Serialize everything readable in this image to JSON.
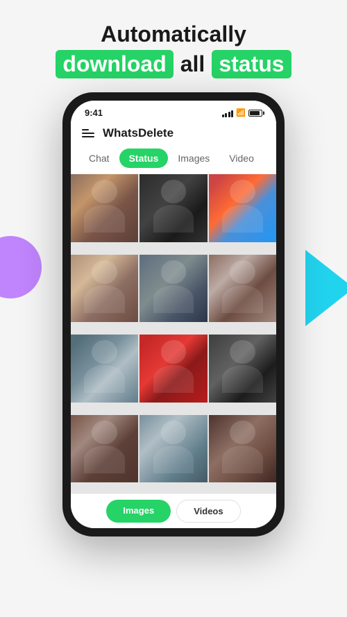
{
  "hero": {
    "line1": "Automatically",
    "highlight1": "download",
    "plain": "all",
    "highlight2": "status"
  },
  "phone": {
    "statusBar": {
      "time": "9:41"
    },
    "header": {
      "appName": "WhatsDelete"
    },
    "tabs": [
      {
        "label": "Chat",
        "active": false
      },
      {
        "label": "Status",
        "active": true
      },
      {
        "label": "Images",
        "active": false
      },
      {
        "label": "Video",
        "active": false
      }
    ],
    "bottomNav": {
      "btn1": "Images",
      "btn2": "Videos"
    }
  },
  "photos": [
    {
      "id": 1,
      "class": "person-1"
    },
    {
      "id": 2,
      "class": "person-2"
    },
    {
      "id": 3,
      "class": "person-3"
    },
    {
      "id": 4,
      "class": "person-4"
    },
    {
      "id": 5,
      "class": "person-5"
    },
    {
      "id": 6,
      "class": "person-6"
    },
    {
      "id": 7,
      "class": "person-7"
    },
    {
      "id": 8,
      "class": "person-8"
    },
    {
      "id": 9,
      "class": "person-9"
    },
    {
      "id": 10,
      "class": "person-10"
    },
    {
      "id": 11,
      "class": "person-11"
    },
    {
      "id": 12,
      "class": "person-12"
    }
  ]
}
